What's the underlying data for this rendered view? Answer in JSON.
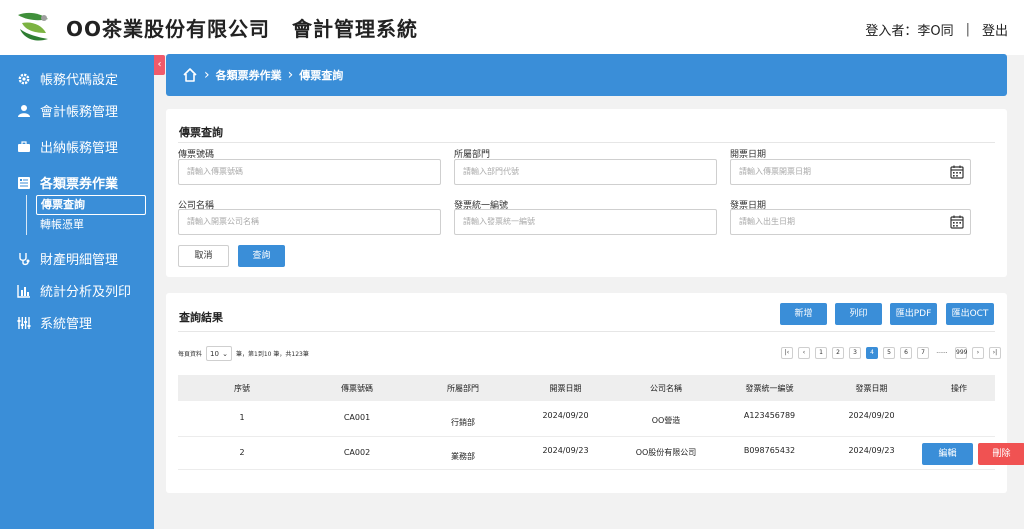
{
  "header": {
    "company": "OO茶業股份有限公司",
    "system": "會計管理系統",
    "user_label": "登入者：李O同",
    "separator": "|",
    "logout": "登出"
  },
  "sidebar": {
    "collapse": "‹",
    "items": [
      {
        "label": "帳務代碼設定",
        "icon": "gear-icon"
      },
      {
        "label": "會計帳務管理",
        "icon": "user-icon"
      },
      {
        "label": "出納帳務管理",
        "icon": "briefcase-icon"
      },
      {
        "label": "各類票券作業",
        "icon": "document-list-icon"
      },
      {
        "label": "財產明細管理",
        "icon": "stethoscope-icon"
      },
      {
        "label": "統計分析及列印",
        "icon": "bar-chart-icon"
      },
      {
        "label": "系統管理",
        "icon": "sliders-icon"
      }
    ],
    "sub_items": [
      {
        "label": "傳票查詢"
      },
      {
        "label": "轉帳憑單"
      }
    ]
  },
  "breadcrumb": {
    "items": [
      "各類票券作業",
      "傳票查詢"
    ]
  },
  "search": {
    "title": "傳票查詢",
    "fields": {
      "voucher_no": {
        "label": "傳票號碼",
        "placeholder": "請輸入傳票號碼"
      },
      "department": {
        "label": "所屬部門",
        "placeholder": "請輸入部門代號"
      },
      "voucher_date": {
        "label": "開票日期",
        "placeholder": "請輸入傳票開票日期"
      },
      "company": {
        "label": "公司名稱",
        "placeholder": "請輸入開票公司名稱"
      },
      "tax_id": {
        "label": "發票統一編號",
        "placeholder": "請輸入發票統一編號"
      },
      "invoice_date": {
        "label": "發票日期",
        "placeholder": "請輸入出生日期"
      }
    },
    "cancel": "取消",
    "submit": "查詢"
  },
  "results": {
    "title": "查詢結果",
    "buttons": {
      "add": "新增",
      "print": "列印",
      "export_pdf": "匯出PDF",
      "export_oct": "匯出OCT"
    },
    "page_size_prefix": "每頁資料",
    "page_size": "10",
    "page_summary": "筆，第1到10 筆，共123筆",
    "pager": [
      "1",
      "2",
      "3",
      "4",
      "5",
      "6",
      "7",
      "......",
      "999"
    ],
    "current_page": "4",
    "columns": [
      "序號",
      "傳票號碼",
      "所屬部門",
      "開票日期",
      "公司名稱",
      "發票統一編號",
      "發票日期",
      "操作"
    ],
    "rows": [
      {
        "no": "1",
        "voucher": "CA001",
        "dept": "行銷部",
        "date": "2024/09/20",
        "company": "OO營造",
        "tax_id": "A123456789",
        "inv_date": "2024/09/20"
      },
      {
        "no": "2",
        "voucher": "CA002",
        "dept": "業務部",
        "date": "2024/09/23",
        "company": "OO股份有限公司",
        "tax_id": "B098765432",
        "inv_date": "2024/09/23"
      }
    ],
    "edit": "編輯",
    "delete": "刪除"
  },
  "colors": {
    "primary": "#3a8ed8",
    "danger": "#f05252",
    "collapse": "#f05a6b",
    "background": "#f2f2f2"
  }
}
